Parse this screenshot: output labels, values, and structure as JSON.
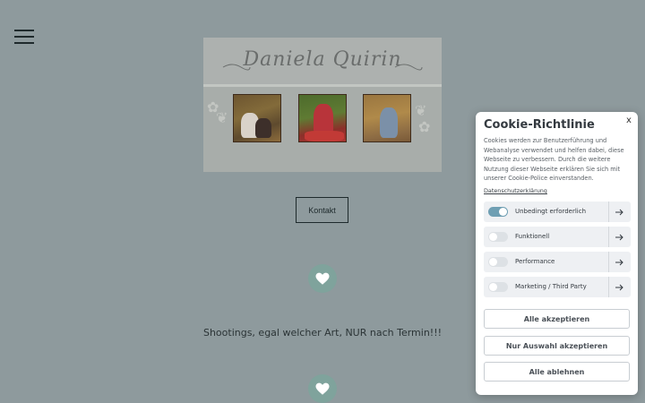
{
  "header": {
    "menu_icon": "hamburger-menu-icon"
  },
  "banner": {
    "title": "Daniela Quirin"
  },
  "kontakt_label": "Kontakt",
  "tagline": "Shootings, egal welcher Art, NUR nach Termin!!!",
  "colors": {
    "page_bg": "#8e9a9d",
    "accent": "#7fa39c",
    "toggle_on": "#6f9fb3"
  },
  "cookie": {
    "close": "x",
    "title": "Cookie-Richtlinie",
    "description": "Cookies werden zur Benutzerführung und Webanalyse verwendet und helfen dabei, diese Webseite zu verbessern. Durch die weitere Nutzung dieser Webseite erklären Sie sich mit unserer Cookie-Police einverstanden.",
    "privacy_link": "Datenschutzerklärung",
    "categories": [
      {
        "label": "Unbedingt erforderlich",
        "enabled": true
      },
      {
        "label": "Funktionell",
        "enabled": false
      },
      {
        "label": "Performance",
        "enabled": false
      },
      {
        "label": "Marketing / Third Party",
        "enabled": false
      }
    ],
    "buttons": {
      "accept_all": "Alle akzeptieren",
      "accept_selection": "Nur Auswahl akzeptieren",
      "reject_all": "Alle ablehnen"
    }
  }
}
